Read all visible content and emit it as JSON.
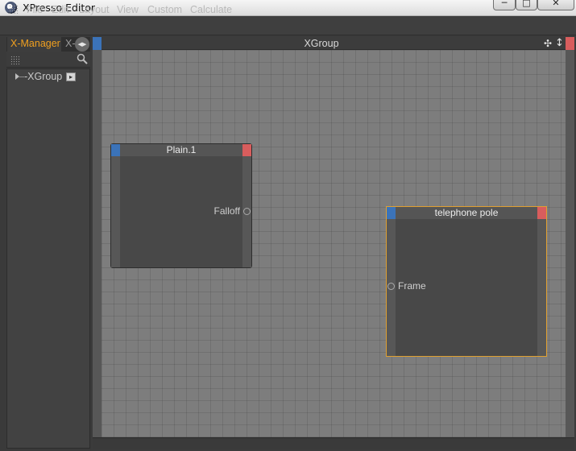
{
  "window": {
    "title": "XPresso Editor",
    "controls": {
      "minimize": "─",
      "maximize": "□",
      "close": "✕"
    }
  },
  "menu": {
    "items": [
      "File",
      "Edit",
      "Layout",
      "View",
      "Custom",
      "Calculate"
    ]
  },
  "left_panel": {
    "tabs": [
      {
        "label": "X-Manager",
        "active": true
      },
      {
        "label": "X-",
        "active": false
      }
    ],
    "tab_scroll_glyph": "◀▶",
    "tree": {
      "items": [
        {
          "label": "-XGroup",
          "expanded": false
        }
      ]
    }
  },
  "editor": {
    "title": "XGroup",
    "header_icons": [
      "move-icon",
      "resize-icon"
    ],
    "move_glyph": "✣",
    "resize_glyph": "↕"
  },
  "nodes": [
    {
      "title": "Plain.1",
      "selected": false,
      "ports": [
        {
          "side": "output",
          "label": "Falloff"
        }
      ]
    },
    {
      "title": "telephone pole",
      "selected": true,
      "selection_color": "#e0a030",
      "ports": [
        {
          "side": "input",
          "label": "Frame"
        }
      ]
    }
  ],
  "colors": {
    "input_port": "#3b73b9",
    "output_port": "#d85d5d",
    "active_tab": "#f0a020",
    "canvas": "#7d7d7d"
  }
}
